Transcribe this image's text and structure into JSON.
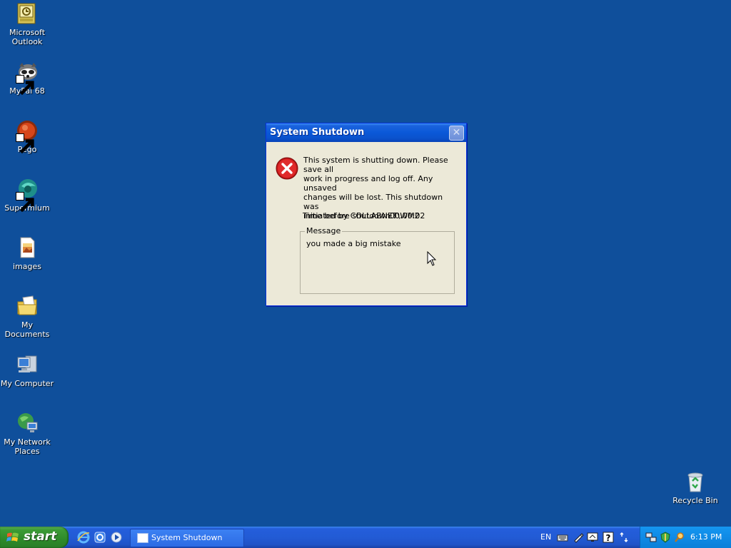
{
  "desktop": {
    "icons": [
      {
        "label_line1": "Microsoft",
        "label_line2": "Outlook",
        "icon": "outlook-icon"
      },
      {
        "label_line1": "MyPal 68",
        "label_line2": "",
        "icon": "mypal-icon"
      },
      {
        "label_line1": "Pego",
        "label_line2": "",
        "icon": "pego-icon"
      },
      {
        "label_line1": "Supermium",
        "label_line2": "",
        "icon": "supermium-icon"
      },
      {
        "label_line1": "images",
        "label_line2": "",
        "icon": "image-file-icon"
      },
      {
        "label_line1": "My Documents",
        "label_line2": "",
        "icon": "documents-folder-icon"
      },
      {
        "label_line1": "My Computer",
        "label_line2": "",
        "icon": "computer-icon"
      },
      {
        "label_line1": "My Network",
        "label_line2": "Places",
        "icon": "network-places-icon"
      }
    ],
    "recycle_bin": {
      "label": "Recycle Bin",
      "icon": "recycle-bin-icon"
    }
  },
  "dialog": {
    "title": "System Shutdown",
    "close_glyph": "✕",
    "text_lines": [
      "This system is shutting down. Please save all",
      "work in progress and log off. Any unsaved",
      "changes will be lost. This shutdown was",
      "initiated by COLLABNET\\WM2"
    ],
    "timer_label": "Time before shutdown :",
    "timer_value": "00:00:02",
    "message_legend": "Message",
    "message_text": "you made a big mistake",
    "icon": "error-icon"
  },
  "taskbar": {
    "start_label": "start",
    "quick_launch": [
      "internet-explorer-icon",
      "browser-icon",
      "media-player-icon"
    ],
    "task_button_label": "System Shutdown",
    "language": "EN",
    "tray_icons": [
      "keyboard-icon",
      "pen-icon",
      "display-icon",
      "help-icon",
      "arrows-icon",
      "network-icon",
      "shield-icon",
      "search-icon"
    ],
    "clock": "6:13 PM"
  },
  "colors": {
    "desktop_background": "#0f4f9b",
    "title_bar": "#0a58d8",
    "dialog_face": "#ece9d8",
    "start_button": "#3c9b35",
    "taskbar": "#245edb",
    "tray": "#108de8"
  }
}
